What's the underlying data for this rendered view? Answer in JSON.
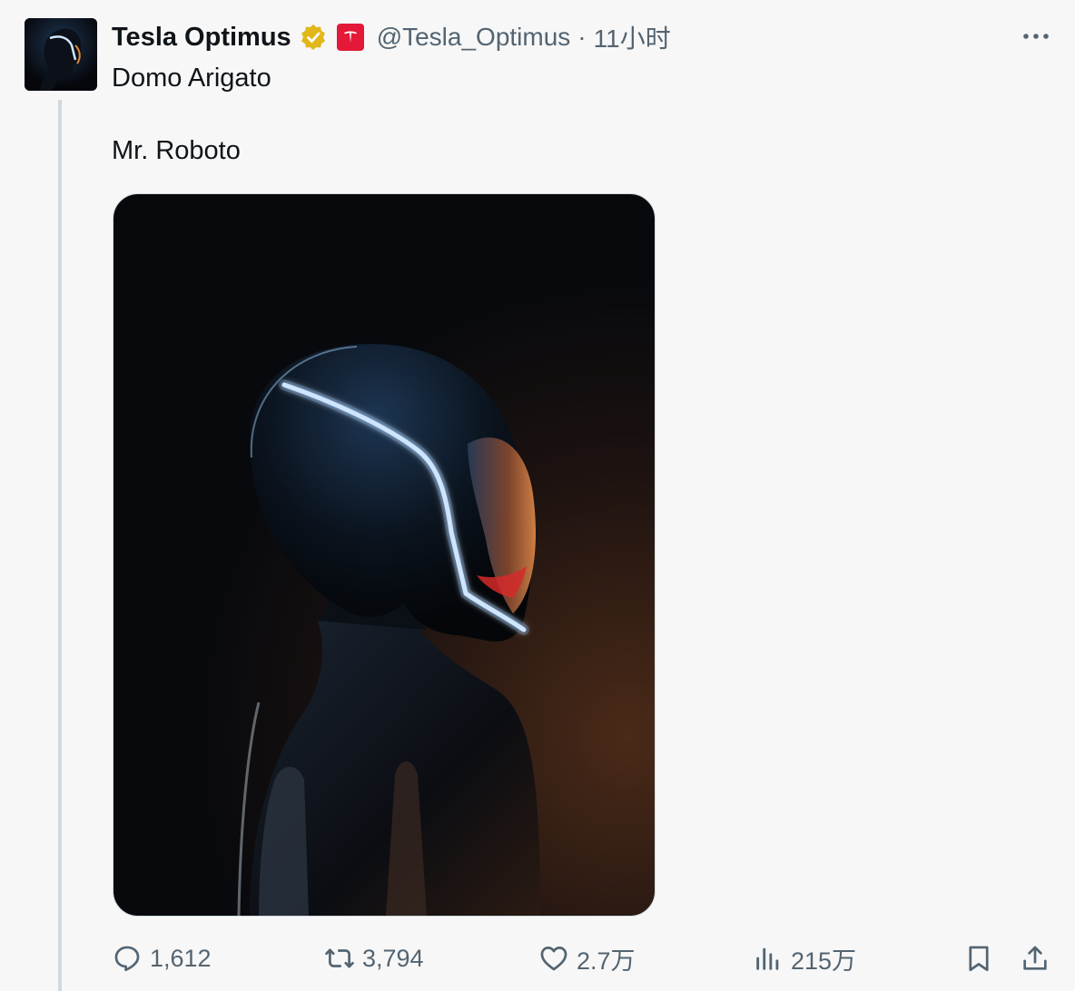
{
  "tweet": {
    "author": {
      "display_name": "Tesla Optimus",
      "handle": "@Tesla_Optimus",
      "verified_icon": "verified-badge-icon",
      "affiliation_icon": "tesla-logo-icon"
    },
    "separator": "·",
    "timestamp": "11小时",
    "text_line_1": "Domo Arigato",
    "text_line_2": "Mr. Roboto",
    "more_icon": "more-icon"
  },
  "actions": {
    "reply_count": "1,612",
    "retweet_count": "3,794",
    "like_count": "2.7万",
    "views_count": "215万"
  },
  "colors": {
    "text": "#0f1419",
    "muted": "#536471",
    "background": "#f7f7f7",
    "verified_gold": "#e2b719",
    "tesla_red": "#e31937",
    "thread_line": "#cfd9de"
  }
}
